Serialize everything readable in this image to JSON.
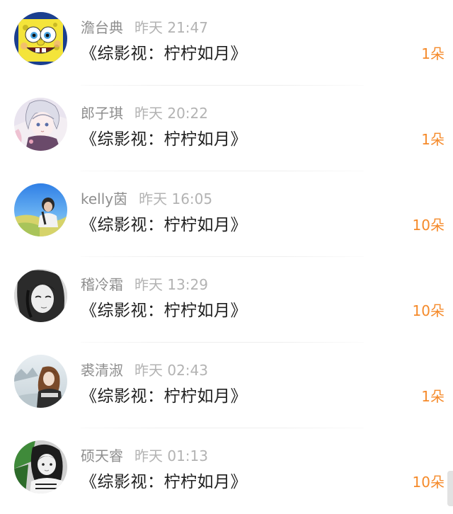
{
  "list": {
    "items": [
      {
        "name": "澹台典",
        "time": "昨天 21:47",
        "title": "《综影视：柠柠如月》",
        "count": "1朵",
        "avatar": "spongebob-avatar"
      },
      {
        "name": "郎子琪",
        "time": "昨天 20:22",
        "title": "《综影视：柠柠如月》",
        "count": "1朵",
        "avatar": "anime-girl-avatar"
      },
      {
        "name": "kelly茵",
        "time": "昨天 16:05",
        "title": "《综影视：柠柠如月》",
        "count": "10朵",
        "avatar": "sky-photo-avatar"
      },
      {
        "name": "稽冷霜",
        "time": "昨天 13:29",
        "title": "《综影视：柠柠如月》",
        "count": "10朵",
        "avatar": "bw-portrait-avatar"
      },
      {
        "name": "裘清淑",
        "time": "昨天 02:43",
        "title": "《综影视：柠柠如月》",
        "count": "1朵",
        "avatar": "winter-girl-avatar"
      },
      {
        "name": "硕天睿",
        "time": "昨天 01:13",
        "title": "《综影视：柠柠如月》",
        "count": "10朵",
        "avatar": "bw-selfie-avatar"
      }
    ]
  },
  "colors": {
    "accent": "#f58a2a",
    "name": "#8e8e8e",
    "time": "#b3b3b3",
    "title": "#1f1f1f"
  }
}
